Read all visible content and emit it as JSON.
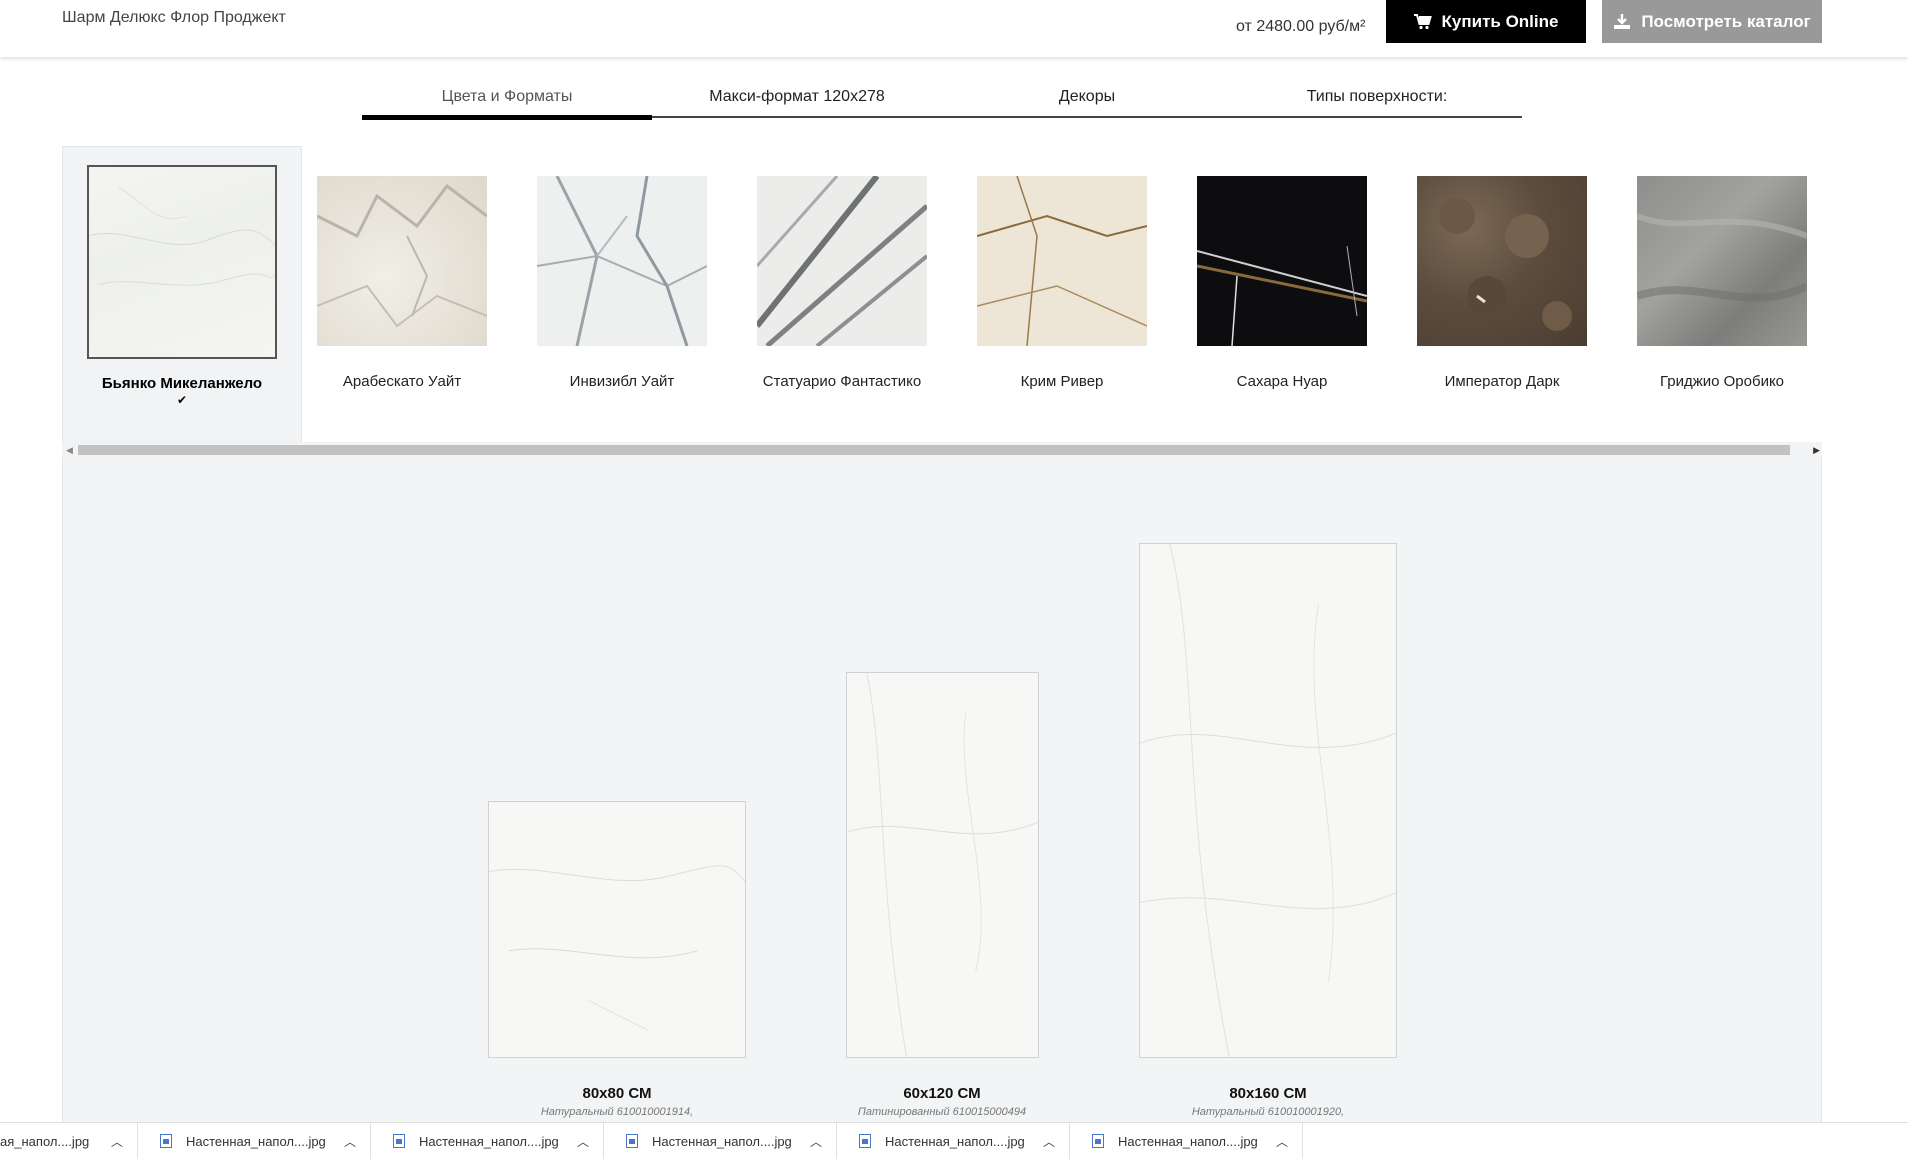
{
  "header": {
    "brand": "Шарм Делюкс Флор Проджект",
    "price": "от 2480.00 руб/м²",
    "buy_label": "Купить Online",
    "catalog_label": "Посмотреть каталог",
    "buy_icon": "cart-icon",
    "catalog_icon": "download-icon"
  },
  "tabs": [
    {
      "label": "Цвета и Форматы",
      "active": true
    },
    {
      "label": "Макси-формат 120х278",
      "active": false
    },
    {
      "label": "Декоры",
      "active": false
    },
    {
      "label": "Типы поверхности:",
      "active": false
    }
  ],
  "swatches": [
    {
      "name": "Бьянко Микеланжело",
      "selected": true,
      "check": "✔"
    },
    {
      "name": "Арабескато Уайт"
    },
    {
      "name": "Инвизибл Уайт"
    },
    {
      "name": "Статуарио Фантастико"
    },
    {
      "name": "Крим Ривер"
    },
    {
      "name": "Сахара Нуар"
    },
    {
      "name": "Императора Дарк",
      "display": "Император Дарк"
    },
    {
      "name": "Гриджио Оробико"
    }
  ],
  "formats": [
    {
      "size": "80x80 СМ",
      "code": "Натуральный 610010001914,"
    },
    {
      "size": "60x120 СМ",
      "code": "Патинированный 610015000494"
    },
    {
      "size": "80x160 СМ",
      "code": "Натуральный 610010001920,"
    }
  ],
  "downloads": [
    {
      "label": "ая_напол....jpg"
    },
    {
      "label": "Настенная_напол....jpg"
    },
    {
      "label": "Настенная_напол....jpg"
    },
    {
      "label": "Настенная_напол....jpg"
    },
    {
      "label": "Настенная_напол....jpg"
    },
    {
      "label": "Настенная_напол....jpg"
    }
  ]
}
